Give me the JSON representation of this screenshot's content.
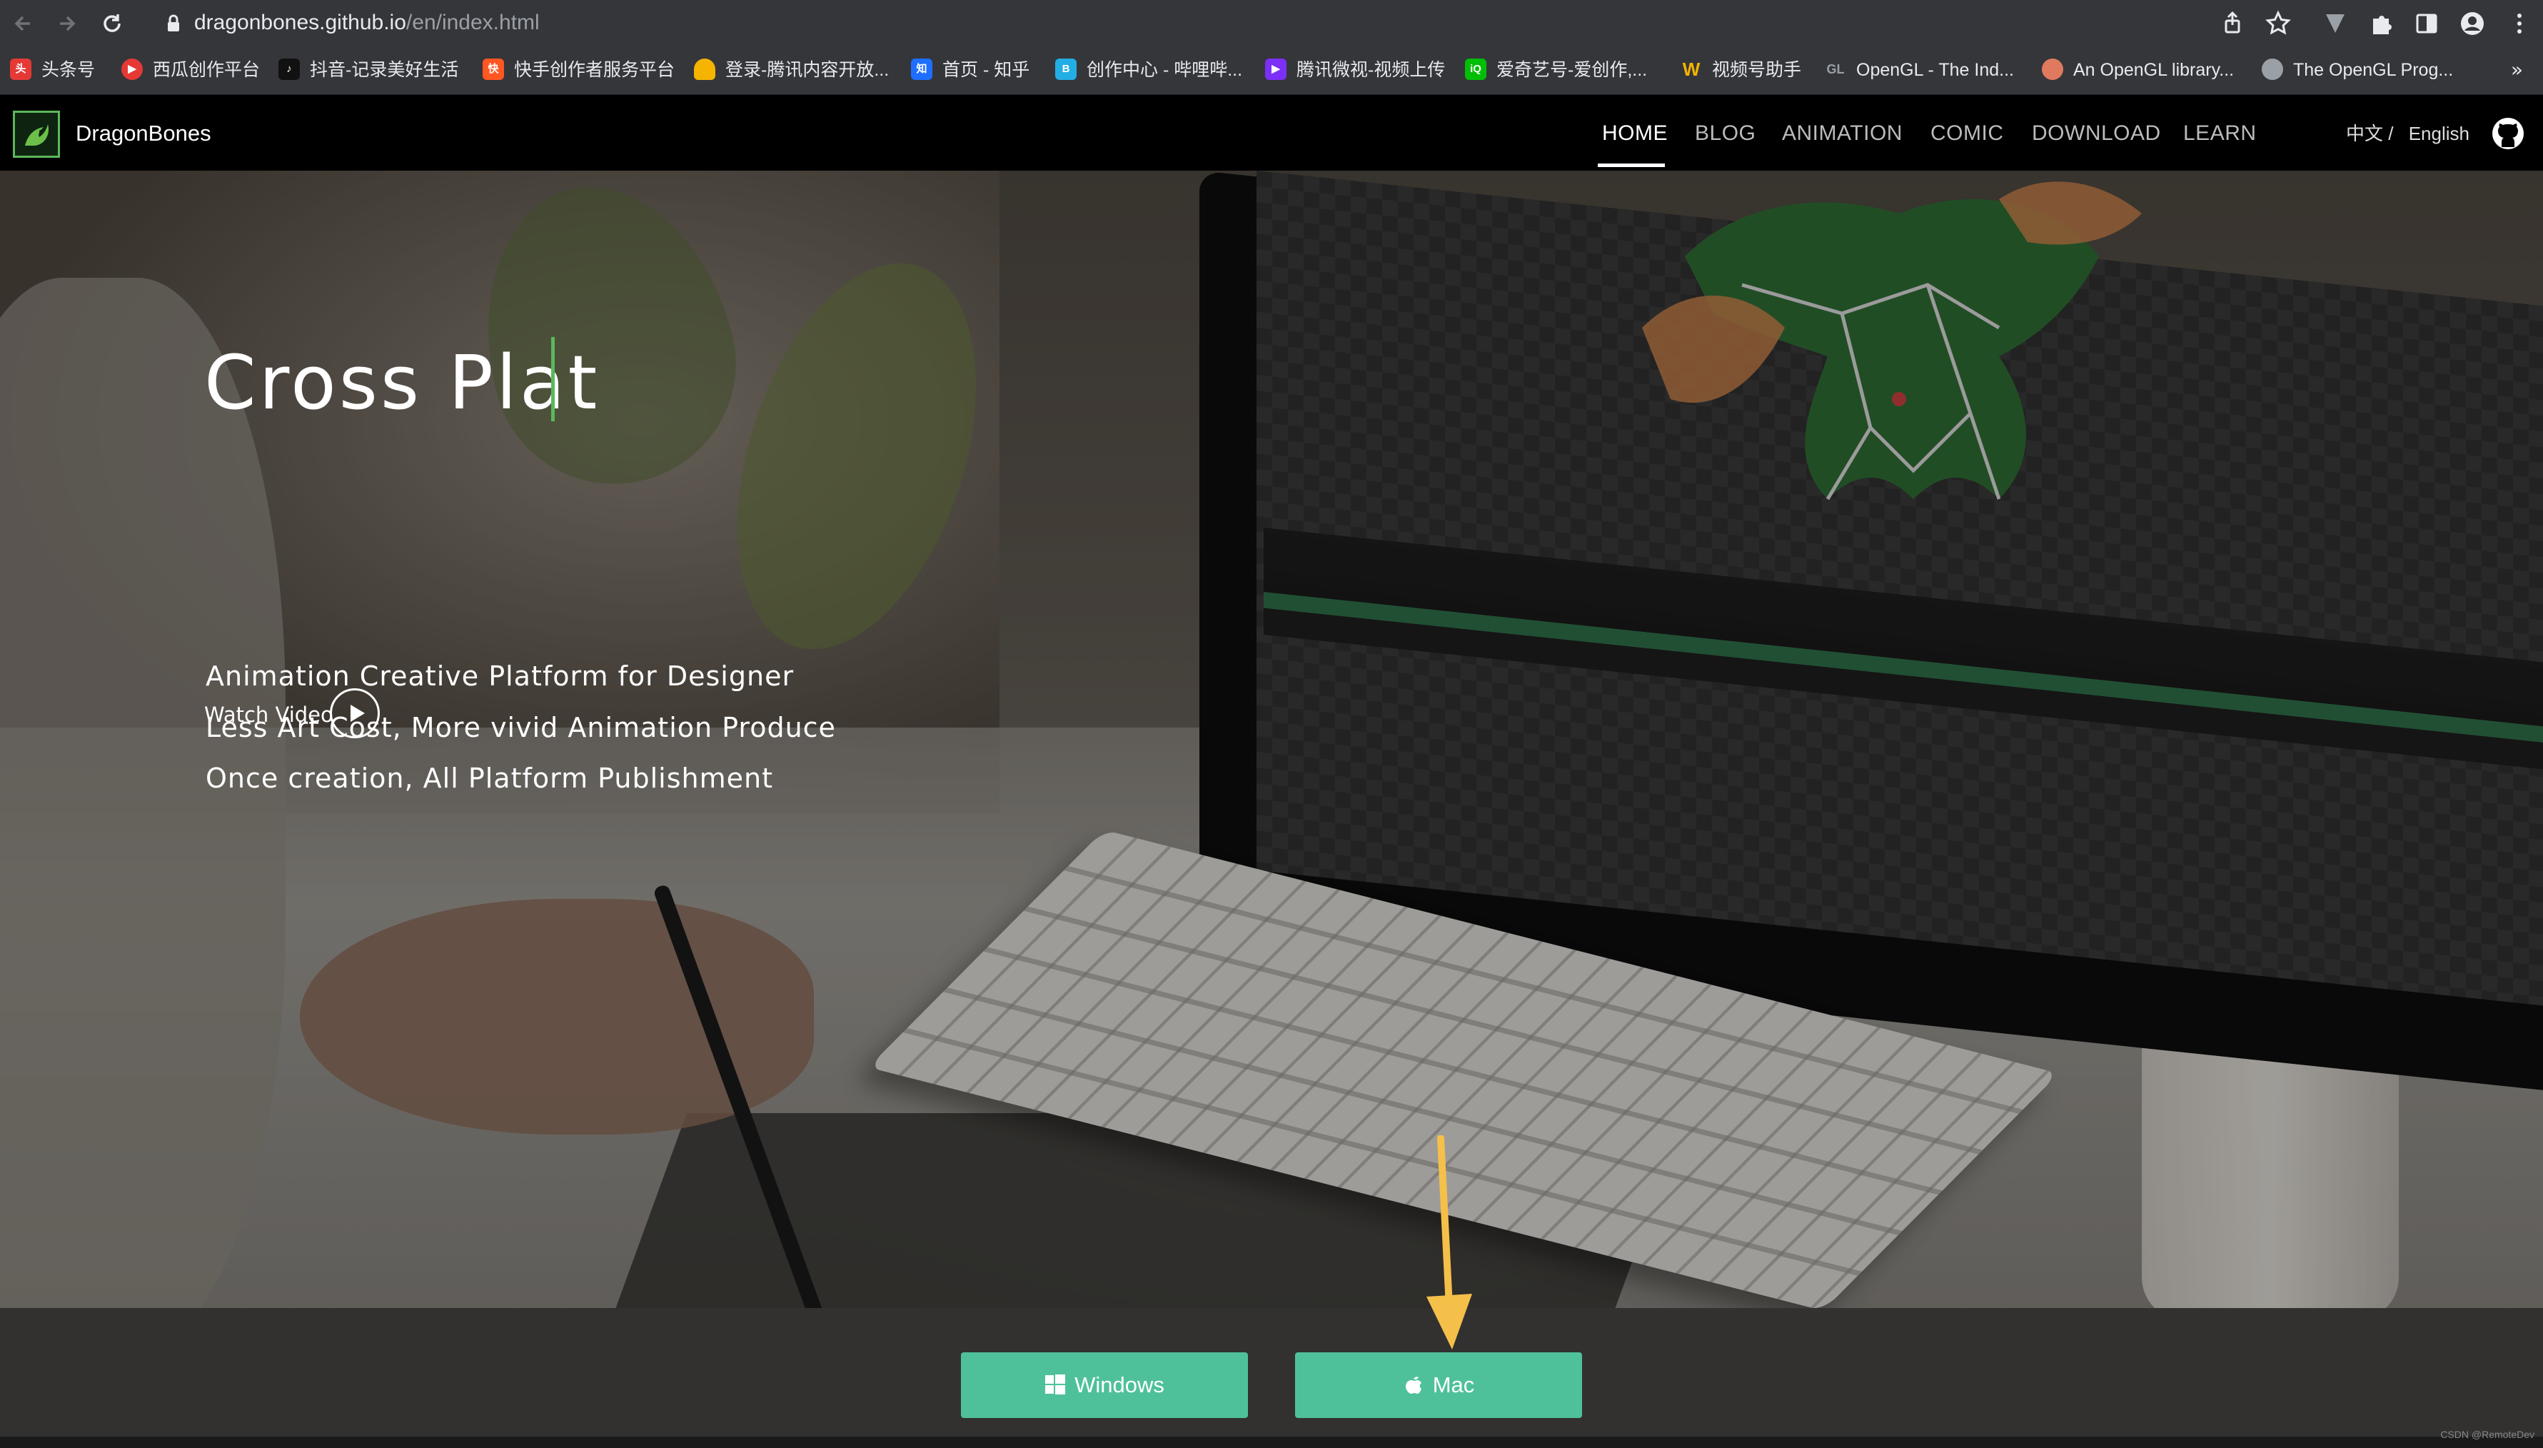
{
  "browser": {
    "url_host": "dragonbones.github.io",
    "url_path": "/en/index.html",
    "bookmarks": [
      {
        "label": "头条号",
        "icon": "toutiao-icon",
        "color": "#e53935"
      },
      {
        "label": "西瓜创作平台",
        "icon": "xigua-icon",
        "color": "#e53935"
      },
      {
        "label": "抖音-记录美好生活",
        "icon": "douyin-icon",
        "color": "#111111"
      },
      {
        "label": "快手创作者服务平台",
        "icon": "kuaishou-icon",
        "color": "#ff5722"
      },
      {
        "label": "登录-腾讯内容开放...",
        "icon": "tencent-bell-icon",
        "color": "#f4b400"
      },
      {
        "label": "首页 - 知乎",
        "icon": "zhihu-icon",
        "color": "#1e6fff"
      },
      {
        "label": "创作中心 - 哔哩哔...",
        "icon": "bilibili-icon",
        "color": "#23ade5"
      },
      {
        "label": "腾讯微视-视频上传",
        "icon": "weishi-icon",
        "color": "#7b2ff7"
      },
      {
        "label": "爱奇艺号-爱创作,...",
        "icon": "iqiyi-icon",
        "color": "#00be06"
      },
      {
        "label": "视频号助手",
        "icon": "channels-icon",
        "color": "#f4b400"
      },
      {
        "label": "OpenGL - The Ind...",
        "icon": "opengl-icon",
        "color": "#5586a4"
      },
      {
        "label": "An OpenGL library...",
        "icon": "sushi-icon",
        "color": "#e07a5f"
      },
      {
        "label": "The OpenGL Prog...",
        "icon": "globe-icon",
        "color": "#9aa0a6"
      }
    ],
    "more": "»"
  },
  "site": {
    "brand": "DragonBones",
    "nav": [
      "HOME",
      "BLOG",
      "ANIMATION",
      "COMIC",
      "DOWNLOAD",
      "LEARN"
    ],
    "active_nav": "HOME",
    "lang_zh": "中文 /",
    "lang_en": "English"
  },
  "hero": {
    "title": "Cross Plat",
    "taglines": [
      "Animation Creative Platform for Designer",
      "Less Art Cost, More vivid Animation Produce",
      "Once creation, All Platform Publishment"
    ],
    "watch_video": "Watch Video"
  },
  "download": {
    "windows": "Windows",
    "mac": "Mac"
  },
  "colors": {
    "accent_green": "#4fc19a",
    "annotation_arrow": "#f5c04a"
  },
  "credit": "CSDN @RemoteDev"
}
